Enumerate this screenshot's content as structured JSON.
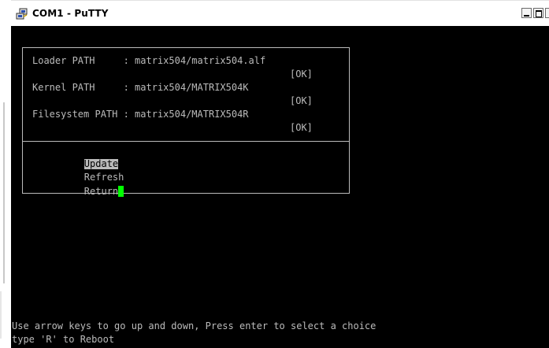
{
  "window": {
    "title": "COM1 - PuTTY"
  },
  "terminal": {
    "paths": [
      {
        "label": "Loader PATH     : matrix504/matrix504.alf",
        "status": "[OK]"
      },
      {
        "label": "Kernel PATH     : matrix504/MATRIX504K",
        "status": "[OK]"
      },
      {
        "label": "Filesystem PATH : matrix504/MATRIX504R",
        "status": "[OK]"
      }
    ],
    "menu": [
      {
        "label": "Update",
        "selected": true
      },
      {
        "label": "Refresh",
        "selected": false
      },
      {
        "label": "Return",
        "selected": false
      }
    ],
    "hint_line_1": "Use arrow keys to go up and down, Press enter to select a choice",
    "hint_line_2": "type 'R' to Reboot"
  },
  "colors": {
    "terminal_bg": "#000000",
    "terminal_fg": "#bbbbbb",
    "cursor": "#00ff00"
  },
  "icons": {
    "app": "putty-icon"
  }
}
